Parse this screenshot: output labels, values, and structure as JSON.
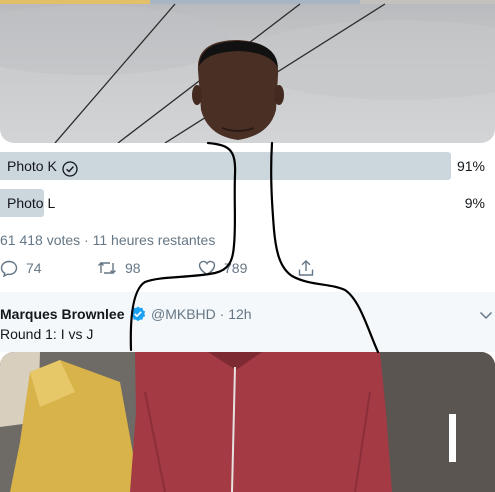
{
  "poll": {
    "options": [
      {
        "label": "Photo K",
        "percent_text": "91%",
        "percent": 91,
        "selected": true
      },
      {
        "label": "Photo L",
        "percent_text": "9%",
        "percent": 9,
        "selected": false
      }
    ],
    "meta": "61 418 votes · 11 heures restantes"
  },
  "actions": {
    "replies": "74",
    "retweets": "98",
    "likes": "789"
  },
  "tweet": {
    "name": "Marques Brownlee",
    "handle_time": "@MKBHD · 12h",
    "text": "Round 1: I vs J"
  },
  "colors": {
    "bar": "#ccd6dd",
    "verified": "#1da1f2",
    "muted": "#657786",
    "jacket": "#a33a44"
  },
  "icons": [
    "check-circle-icon",
    "reply-icon",
    "retweet-icon",
    "like-icon",
    "share-icon",
    "verified-icon",
    "chevron-down-icon"
  ]
}
